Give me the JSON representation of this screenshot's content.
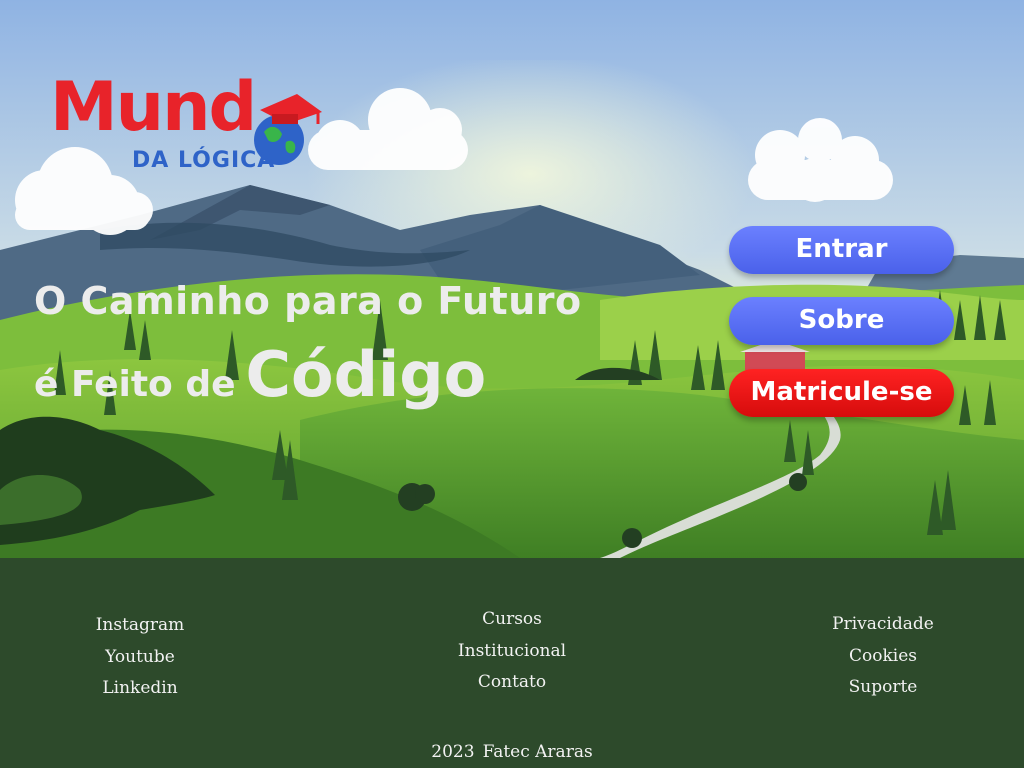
{
  "logo": {
    "word": "Mund",
    "subtitle": "DA LÓGICA"
  },
  "headline": {
    "line1": "O Caminho para o Futuro",
    "line2_part1": "é Feito de",
    "line2_part2": "Código"
  },
  "buttons": {
    "enter": "Entrar",
    "about": "Sobre",
    "enroll": "Matricule-se"
  },
  "footer": {
    "social": [
      "Instagram",
      "Youtube",
      "Linkedin"
    ],
    "links": [
      "Cursos",
      "Institucional",
      "Contato"
    ],
    "legal": [
      "Privacidade",
      "Cookies",
      "Suporte"
    ],
    "year": "2023",
    "institution": "Fatec Araras"
  },
  "colors": {
    "accent_blue": "#5267f5",
    "accent_red": "#e81414",
    "footer_bg": "#2d4a2b",
    "logo_red": "#e8232a",
    "logo_blue": "#2e63c8"
  }
}
